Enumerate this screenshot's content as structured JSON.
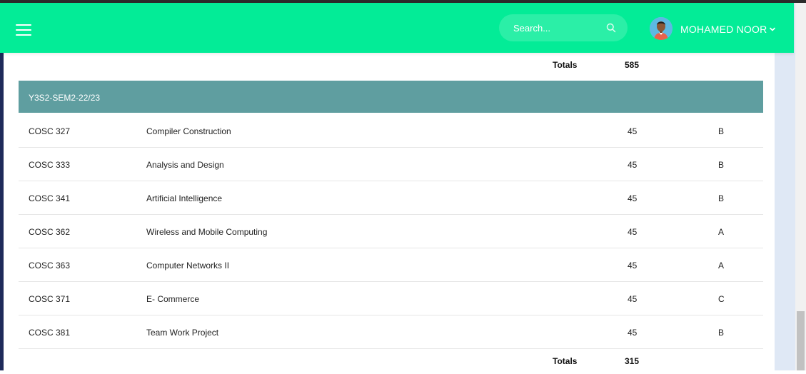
{
  "header": {
    "search_placeholder": "Search...",
    "user_name": "MOHAMED NOOR",
    "icons": {
      "menu": "hamburger-menu-icon",
      "search": "search-icon",
      "user": "avatar",
      "dropdown": "chevron-down-icon"
    },
    "colors": {
      "header_bg": "#03ec97",
      "semester_header_bg": "#5f9ea0"
    }
  },
  "previous_semester": {
    "totals_label": "Totals",
    "totals_value": "585"
  },
  "semester": {
    "title": "Y3S2-SEM2-22/23",
    "courses": [
      {
        "code": "COSC 327",
        "title": "Compiler Construction",
        "hours": "45",
        "grade": "B"
      },
      {
        "code": "COSC 333",
        "title": "Analysis and Design",
        "hours": "45",
        "grade": "B"
      },
      {
        "code": "COSC 341",
        "title": "Artificial Intelligence",
        "hours": "45",
        "grade": "B"
      },
      {
        "code": "COSC 362",
        "title": "Wireless and Mobile Computing",
        "hours": "45",
        "grade": "A"
      },
      {
        "code": "COSC 363",
        "title": "Computer Networks II",
        "hours": "45",
        "grade": "A"
      },
      {
        "code": "COSC 371",
        "title": "E- Commerce",
        "hours": "45",
        "grade": "C"
      },
      {
        "code": "COSC 381",
        "title": "Team Work Project",
        "hours": "45",
        "grade": "B"
      }
    ],
    "totals_label": "Totals",
    "totals_value": "315"
  }
}
